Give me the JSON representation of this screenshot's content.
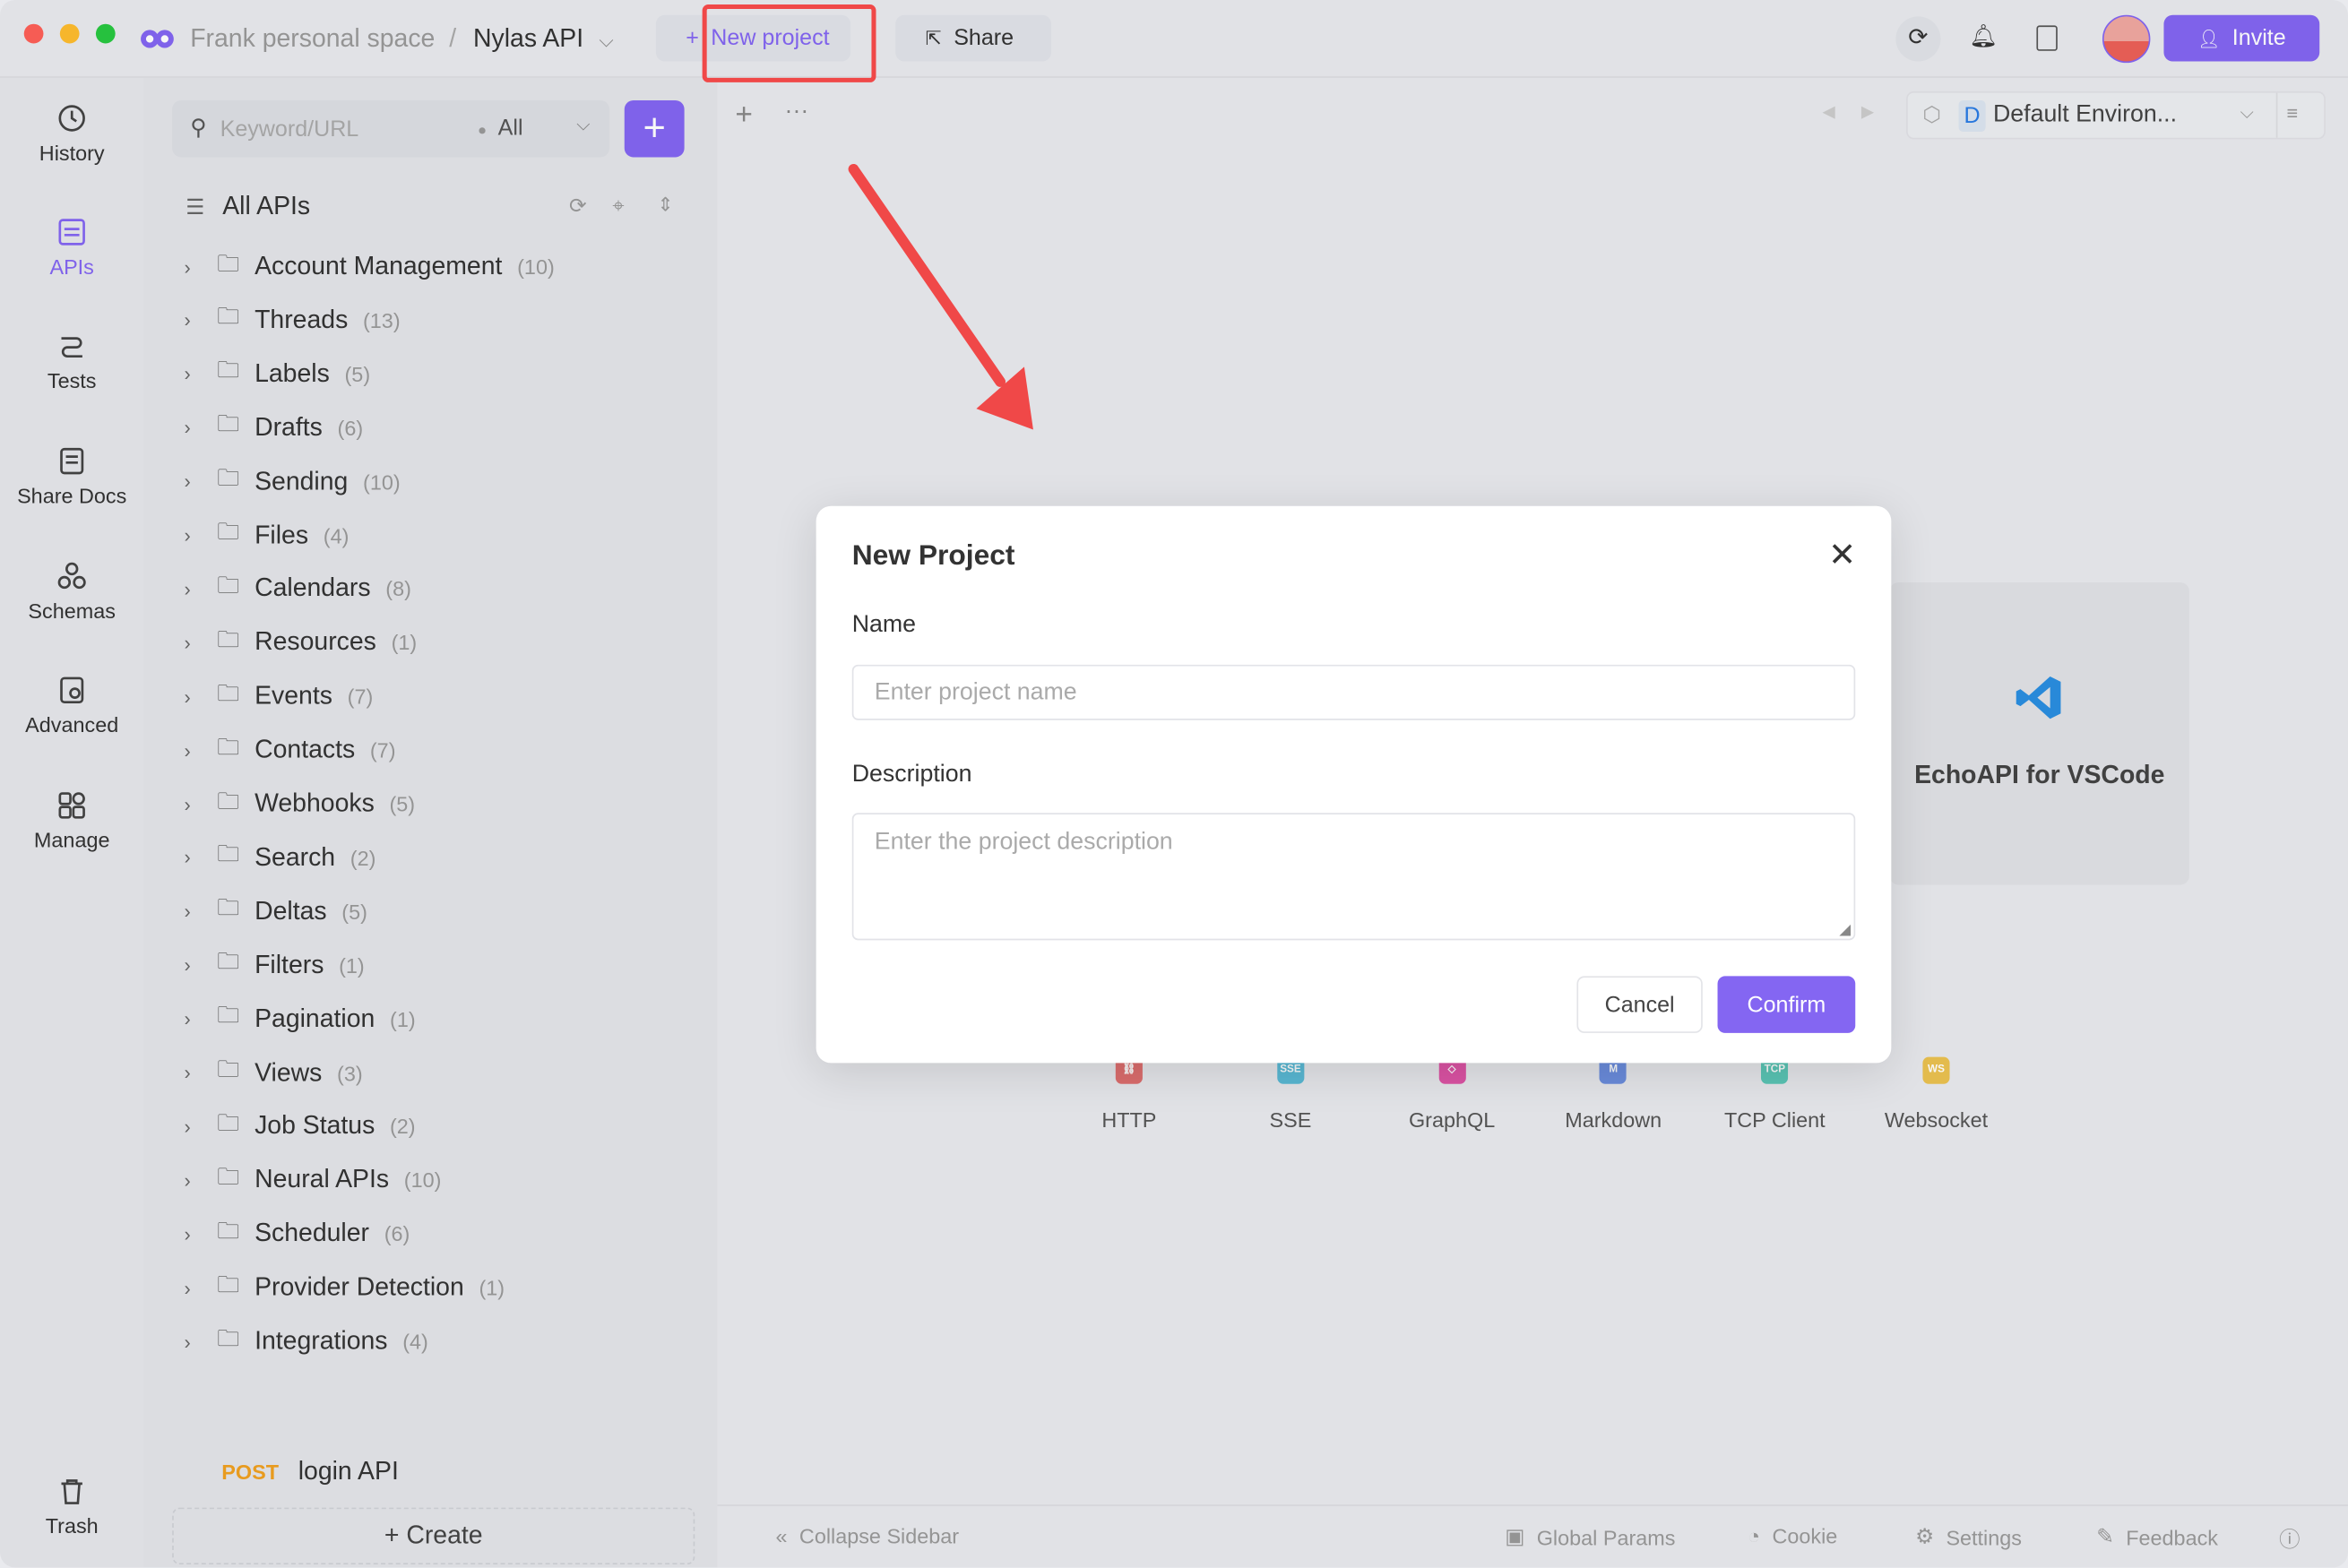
{
  "topbar": {
    "workspace": "Frank personal space",
    "separator": "/",
    "project": "Nylas API",
    "new_project": "New project",
    "share": "Share",
    "invite": "Invite"
  },
  "nav": [
    {
      "label": "History",
      "icon": "history-icon"
    },
    {
      "label": "APIs",
      "icon": "apis-icon",
      "active": true
    },
    {
      "label": "Tests",
      "icon": "tests-icon"
    },
    {
      "label": "Share Docs",
      "icon": "share-docs-icon"
    },
    {
      "label": "Schemas",
      "icon": "schemas-icon"
    },
    {
      "label": "Advanced",
      "icon": "advanced-icon"
    },
    {
      "label": "Manage",
      "icon": "manage-icon"
    },
    {
      "label": "Trash",
      "icon": "trash-icon"
    }
  ],
  "search": {
    "placeholder": "Keyword/URL",
    "filter": "All"
  },
  "tree": {
    "root": "All APIs",
    "folders": [
      {
        "name": "Account Management",
        "count": "(10)"
      },
      {
        "name": "Threads",
        "count": "(13)"
      },
      {
        "name": "Labels",
        "count": "(5)"
      },
      {
        "name": "Drafts",
        "count": "(6)"
      },
      {
        "name": "Sending",
        "count": "(10)"
      },
      {
        "name": "Files",
        "count": "(4)"
      },
      {
        "name": "Calendars",
        "count": "(8)"
      },
      {
        "name": "Resources",
        "count": "(1)"
      },
      {
        "name": "Events",
        "count": "(7)"
      },
      {
        "name": "Contacts",
        "count": "(7)"
      },
      {
        "name": "Webhooks",
        "count": "(5)"
      },
      {
        "name": "Search",
        "count": "(2)"
      },
      {
        "name": "Deltas",
        "count": "(5)"
      },
      {
        "name": "Filters",
        "count": "(1)"
      },
      {
        "name": "Pagination",
        "count": "(1)"
      },
      {
        "name": "Views",
        "count": "(3)"
      },
      {
        "name": "Job Status",
        "count": "(2)"
      },
      {
        "name": "Neural APIs",
        "count": "(10)"
      },
      {
        "name": "Scheduler",
        "count": "(6)"
      },
      {
        "name": "Provider Detection",
        "count": "(1)"
      },
      {
        "name": "Integrations",
        "count": "(4)"
      }
    ],
    "request": {
      "method": "POST",
      "name": "login API"
    },
    "create": "Create"
  },
  "env": {
    "badge": "D",
    "name": "Default Environ..."
  },
  "vscode_card": "EchoAPI for VSCode",
  "tools": [
    {
      "label": "HTTP",
      "color": "#e07070",
      "glyph": "⛓"
    },
    {
      "label": "SSE",
      "color": "#5bbcd8",
      "glyph": "SSE"
    },
    {
      "label": "GraphQL",
      "color": "#e055a8",
      "glyph": "◇"
    },
    {
      "label": "Markdown",
      "color": "#6d8fe0",
      "glyph": "M"
    },
    {
      "label": "TCP Client",
      "color": "#5cc9b8",
      "glyph": "TCP"
    },
    {
      "label": "Websocket",
      "color": "#ebc250",
      "glyph": "WS"
    }
  ],
  "modal": {
    "title": "New Project",
    "name_label": "Name",
    "name_placeholder": "Enter project name",
    "desc_label": "Description",
    "desc_placeholder": "Enter the project description",
    "cancel": "Cancel",
    "confirm": "Confirm"
  },
  "footer": {
    "collapse": "Collapse Sidebar",
    "global_params": "Global Params",
    "cookie": "Cookie",
    "settings": "Settings",
    "feedback": "Feedback"
  },
  "colors": {
    "accent": "#8466f2",
    "annotation": "#f04848",
    "post": "#f0a020"
  }
}
